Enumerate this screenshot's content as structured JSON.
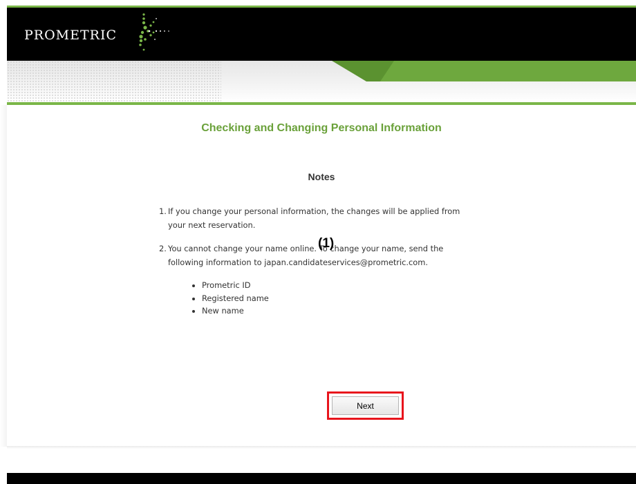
{
  "header": {
    "logo_text": "PROMETRIC",
    "brand_color": "#7ab648",
    "logo_icon": "starburst-icon"
  },
  "main": {
    "title": "Checking and Changing Personal Information",
    "notes_heading": "Notes",
    "notes": [
      {
        "number": "1.",
        "lines": [
          "If you change your personal information, the changes will be applied from",
          "your next reservation."
        ]
      },
      {
        "number": "2.",
        "lines": [
          "You cannot change your name online. To change your name, send the",
          "following information to japan.candidateservices@prometric.com."
        ]
      }
    ],
    "bullets": [
      "Prometric ID",
      "Registered name",
      "New name"
    ],
    "callout_label": "(1)",
    "callout_color": "#e8141c",
    "next_button_label": "Next"
  }
}
